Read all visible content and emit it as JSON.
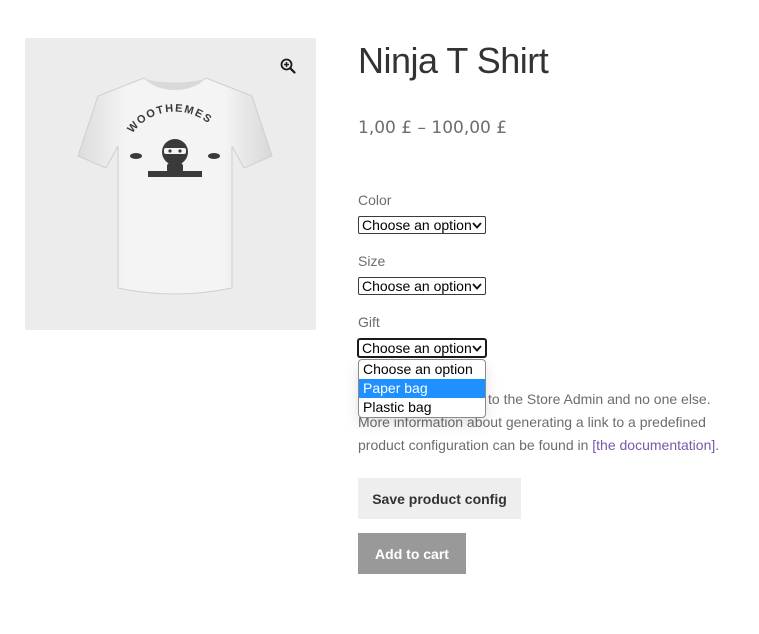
{
  "product": {
    "title": "Ninja T Shirt",
    "price_range": "1,00 £ – 100,00 £",
    "image": {
      "colors": {
        "background": "#ececec",
        "shirt": "#f2f2f2",
        "print": "#3a3a3a"
      },
      "print_text": "WOOTHEMES"
    }
  },
  "variations": [
    {
      "label": "Color",
      "selected": "Choose an option"
    },
    {
      "label": "Size",
      "selected": "Choose an option"
    },
    {
      "label": "Gift",
      "selected": "Choose an option"
    }
  ],
  "gift_dropdown": {
    "open": true,
    "options": [
      {
        "label": "Choose an option",
        "highlighted": false
      },
      {
        "label": "Paper bag",
        "highlighted": true
      },
      {
        "label": "Plastic bag",
        "highlighted": false
      }
    ]
  },
  "description": {
    "visible_text": "to the Store Admin and no one else. More information about generating a link to a predefined product configuration can be found in",
    "link_text": "[the documentation]",
    "trailing": "."
  },
  "buttons": {
    "save_config": "Save product config",
    "add_to_cart": "Add to cart"
  },
  "icons": {
    "zoom": "zoom-in-icon",
    "select_arrow": "chevron-down-icon"
  },
  "colors": {
    "link": "#7b58a8",
    "highlight": "#1e90ff",
    "save_button_bg": "#eeeeee",
    "cart_button_bg": "#999999"
  }
}
